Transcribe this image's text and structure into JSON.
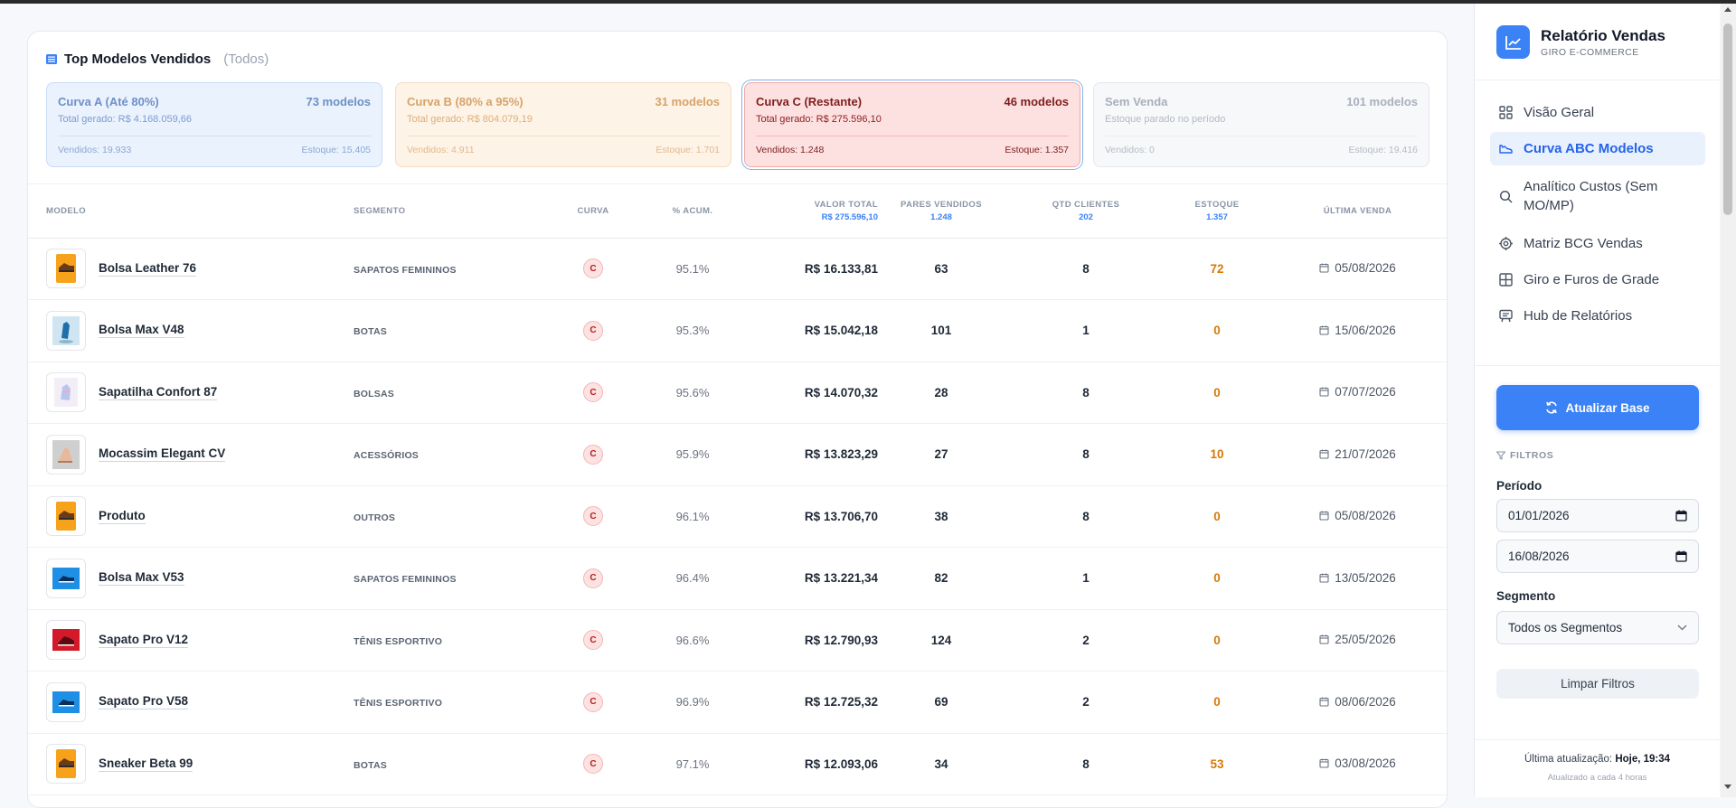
{
  "panel": {
    "title": "Top Modelos Vendidos",
    "subtitle": "(Todos)"
  },
  "cards": [
    {
      "title": "Curva A (Até 80%)",
      "count": "73 modelos",
      "total": "Total gerado: R$ 4.168.059,66",
      "vendidos": "Vendidos: 19.933",
      "estoque": "Estoque: 15.405"
    },
    {
      "title": "Curva B (80% a 95%)",
      "count": "31 modelos",
      "total": "Total gerado: R$ 804.079,19",
      "vendidos": "Vendidos: 4.911",
      "estoque": "Estoque: 1.701"
    },
    {
      "title": "Curva C (Restante)",
      "count": "46 modelos",
      "total": "Total gerado: R$ 275.596,10",
      "vendidos": "Vendidos: 1.248",
      "estoque": "Estoque: 1.357"
    },
    {
      "title": "Sem Venda",
      "count": "101 modelos",
      "total": "Estoque parado no período",
      "vendidos": "Vendidos: 0",
      "estoque": "Estoque: 19.416"
    }
  ],
  "table": {
    "headers": {
      "modelo": "MODELO",
      "segmento": "SEGMENTO",
      "curva": "CURVA",
      "acum": "% ACUM.",
      "valor": "VALOR TOTAL",
      "valor_sub": "r$ 275.596,10",
      "pares": "PARES VENDIDOS",
      "pares_sub": "1.248",
      "clientes": "QTD CLIENTES",
      "clientes_sub": "202",
      "estoque": "ESTOQUE",
      "estoque_sub": "1.357",
      "ultima": "ÚLTIMA VENDA"
    },
    "rows": [
      {
        "name": "Bolsa Leather 76",
        "segment": "SAPATOS FEMININOS",
        "curve": "C",
        "acum": "95.1%",
        "value": "R$ 16.133,81",
        "pairs": "63",
        "clients": "8",
        "stock": "72",
        "date": "05/08/2026",
        "thumb": "orange-shoe"
      },
      {
        "name": "Bolsa Max V48",
        "segment": "BOTAS",
        "curve": "C",
        "acum": "95.3%",
        "value": "R$ 15.042,18",
        "pairs": "101",
        "clients": "1",
        "stock": "0",
        "date": "15/06/2026",
        "thumb": "blue-sneaker-photo"
      },
      {
        "name": "Sapatilha Confort 87",
        "segment": "BOLSAS",
        "curve": "C",
        "acum": "95.6%",
        "value": "R$ 14.070,32",
        "pairs": "28",
        "clients": "8",
        "stock": "0",
        "date": "07/07/2026",
        "thumb": "pastel-sneaker"
      },
      {
        "name": "Mocassim Elegant CV",
        "segment": "ACESSÓRIOS",
        "curve": "C",
        "acum": "95.9%",
        "value": "R$ 13.823,29",
        "pairs": "27",
        "clients": "8",
        "stock": "10",
        "date": "21/07/2026",
        "thumb": "beige-shoe"
      },
      {
        "name": "Produto",
        "segment": "OUTROS",
        "curve": "C",
        "acum": "96.1%",
        "value": "R$ 13.706,70",
        "pairs": "38",
        "clients": "8",
        "stock": "0",
        "date": "05/08/2026",
        "thumb": "orange-shoe"
      },
      {
        "name": "Bolsa Max V53",
        "segment": "SAPATOS FEMININOS",
        "curve": "C",
        "acum": "96.4%",
        "value": "R$ 13.221,34",
        "pairs": "82",
        "clients": "1",
        "stock": "0",
        "date": "13/05/2026",
        "thumb": "blue-shoe"
      },
      {
        "name": "Sapato Pro V12",
        "segment": "TÊNIS ESPORTIVO",
        "curve": "C",
        "acum": "96.6%",
        "value": "R$ 12.790,93",
        "pairs": "124",
        "clients": "2",
        "stock": "0",
        "date": "25/05/2026",
        "thumb": "red-shoe"
      },
      {
        "name": "Sapato Pro V58",
        "segment": "TÊNIS ESPORTIVO",
        "curve": "C",
        "acum": "96.9%",
        "value": "R$ 12.725,32",
        "pairs": "69",
        "clients": "2",
        "stock": "0",
        "date": "08/06/2026",
        "thumb": "blue-shoe"
      },
      {
        "name": "Sneaker Beta 99",
        "segment": "BOTAS",
        "curve": "C",
        "acum": "97.1%",
        "value": "R$ 12.093,06",
        "pairs": "34",
        "clients": "8",
        "stock": "53",
        "date": "03/08/2026",
        "thumb": "orange-shoe"
      }
    ]
  },
  "sidebar": {
    "brand_title": "Relatório Vendas",
    "brand_sub": "GIRO E-COMMERCE",
    "nav": [
      {
        "label": "Visão Geral",
        "icon": "grid-icon"
      },
      {
        "label": "Curva ABC Modelos",
        "icon": "shoe-icon"
      },
      {
        "label": "Analítico Custos (Sem MO/MP)",
        "icon": "search-icon"
      },
      {
        "label": "Matriz BCG Vendas",
        "icon": "target-icon"
      },
      {
        "label": "Giro e Furos de Grade",
        "icon": "table-icon"
      },
      {
        "label": "Hub de Relatórios",
        "icon": "presentation-icon"
      }
    ],
    "update_button": "Atualizar Base",
    "filters_label": "FILTROS",
    "period_label": "Período",
    "date_from": "01/01/2026",
    "date_to": "16/08/2026",
    "segment_label": "Segmento",
    "segment_value": "Todos os Segmentos",
    "clear_button": "Limpar Filtros",
    "last_update_prefix": "Última atualização:",
    "last_update_value": "Hoje, 19:34",
    "update_frequency": "Atualizado a cada 4 horas"
  },
  "colors": {
    "accent": "#3b82f6",
    "curve_c": "#b91c1c",
    "stock": "#d97706"
  }
}
